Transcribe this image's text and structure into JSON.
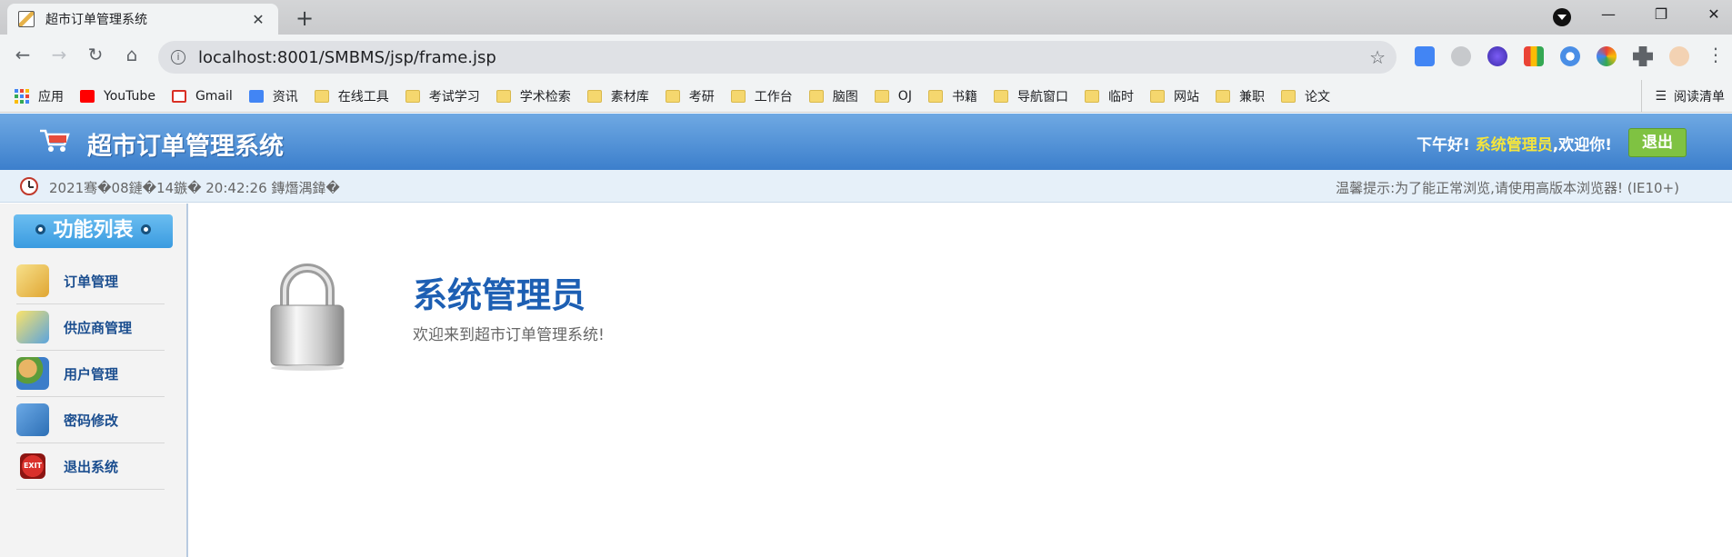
{
  "browser": {
    "tab_title": "超市订单管理系统",
    "tab_close": "✕",
    "new_tab": "+",
    "url": "localhost:8001/SMBMS/jsp/frame.jsp",
    "nav": {
      "back": "←",
      "forward": "→",
      "reload": "↻",
      "home": "⌂"
    },
    "window": {
      "minimize": "—",
      "restore": "❐",
      "close": "✕"
    },
    "bookmarks": [
      {
        "label": "应用",
        "icon": "apps-grid-icon"
      },
      {
        "label": "YouTube",
        "icon": "youtube-icon"
      },
      {
        "label": "Gmail",
        "icon": "gmail-icon"
      },
      {
        "label": "资讯",
        "icon": "news-icon"
      },
      {
        "label": "在线工具",
        "icon": "folder-icon"
      },
      {
        "label": "考试学习",
        "icon": "folder-icon"
      },
      {
        "label": "学术检索",
        "icon": "folder-icon"
      },
      {
        "label": "素材库",
        "icon": "folder-icon"
      },
      {
        "label": "考研",
        "icon": "folder-icon"
      },
      {
        "label": "工作台",
        "icon": "folder-icon"
      },
      {
        "label": "脑图",
        "icon": "folder-icon"
      },
      {
        "label": "OJ",
        "icon": "folder-icon"
      },
      {
        "label": "书籍",
        "icon": "folder-icon"
      },
      {
        "label": "导航窗口",
        "icon": "folder-icon"
      },
      {
        "label": "临时",
        "icon": "folder-icon"
      },
      {
        "label": "网站",
        "icon": "folder-icon"
      },
      {
        "label": "兼职",
        "icon": "folder-icon"
      },
      {
        "label": "论文",
        "icon": "folder-icon"
      }
    ],
    "reading_list": "阅读清单"
  },
  "header": {
    "title": "超市订单管理系统",
    "greeting_prefix": "下午好!",
    "username": "系统管理员",
    "greeting_suffix": ",欢迎你!",
    "logout_label": "退出"
  },
  "status": {
    "datetime": "2021骞�08鏈�14鏃� 20:42:26 鏄熸湡鍏�",
    "tip": "温馨提示:为了能正常浏览,请使用高版本浏览器!  (IE10+)"
  },
  "sidebar": {
    "header": "功能列表",
    "items": [
      {
        "label": "订单管理",
        "icon": "order-icon"
      },
      {
        "label": "供应商管理",
        "icon": "supplier-icon"
      },
      {
        "label": "用户管理",
        "icon": "users-icon"
      },
      {
        "label": "密码修改",
        "icon": "password-icon"
      },
      {
        "label": "退出系统",
        "icon": "exit-icon"
      }
    ],
    "exit_icon_text": "EXIT"
  },
  "main": {
    "title": "系统管理员",
    "welcome": "欢迎来到超市订单管理系统!"
  },
  "colors": {
    "header_blue": "#3c7fcc",
    "username_yellow": "#f5e53c",
    "logout_green": "#7fc242",
    "title_blue": "#1d5fb3"
  }
}
